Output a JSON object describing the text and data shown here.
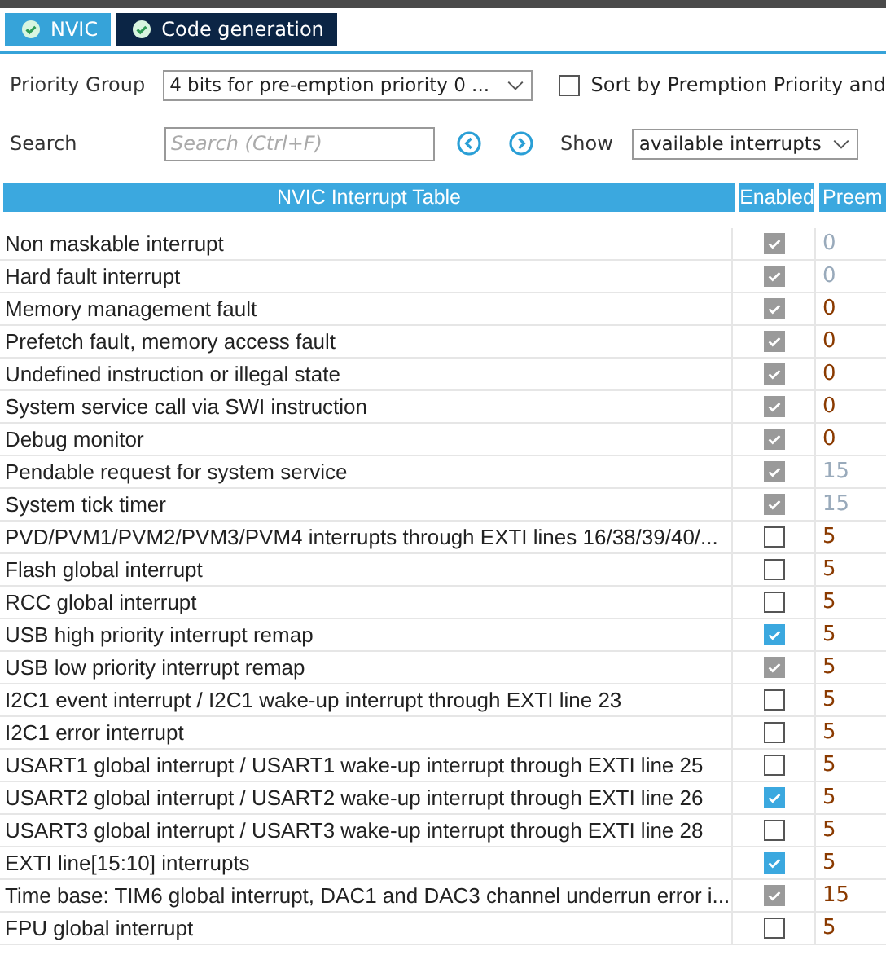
{
  "tabs": [
    {
      "label": "NVIC",
      "selected": true
    },
    {
      "label": "Code generation",
      "selected": false
    }
  ],
  "priority_group": {
    "label": "Priority Group",
    "value": "4 bits for pre-emption priority 0 ..."
  },
  "sort_option": {
    "label": "Sort by Premption Priority and",
    "checked": false
  },
  "search": {
    "label": "Search",
    "placeholder": "Search (Ctrl+F)"
  },
  "show": {
    "label": "Show",
    "value": "available interrupts"
  },
  "table": {
    "columns": [
      "NVIC Interrupt Table",
      "Enabled",
      "Preem"
    ],
    "rows": [
      {
        "name": "Non maskable interrupt",
        "enabled": true,
        "enabled_locked": true,
        "priority": "0",
        "priority_disabled": true
      },
      {
        "name": "Hard fault interrupt",
        "enabled": true,
        "enabled_locked": true,
        "priority": "0",
        "priority_disabled": true
      },
      {
        "name": "Memory management fault",
        "enabled": true,
        "enabled_locked": true,
        "priority": "0",
        "priority_disabled": false
      },
      {
        "name": "Prefetch fault, memory access fault",
        "enabled": true,
        "enabled_locked": true,
        "priority": "0",
        "priority_disabled": false
      },
      {
        "name": "Undefined instruction or illegal state",
        "enabled": true,
        "enabled_locked": true,
        "priority": "0",
        "priority_disabled": false
      },
      {
        "name": "System service call via SWI instruction",
        "enabled": true,
        "enabled_locked": true,
        "priority": "0",
        "priority_disabled": false
      },
      {
        "name": "Debug monitor",
        "enabled": true,
        "enabled_locked": true,
        "priority": "0",
        "priority_disabled": false
      },
      {
        "name": "Pendable request for system service",
        "enabled": true,
        "enabled_locked": true,
        "priority": "15",
        "priority_disabled": true
      },
      {
        "name": "System tick timer",
        "enabled": true,
        "enabled_locked": true,
        "priority": "15",
        "priority_disabled": true
      },
      {
        "name": "PVD/PVM1/PVM2/PVM3/PVM4 interrupts through EXTI lines 16/38/39/40/...",
        "enabled": false,
        "enabled_locked": false,
        "priority": "5",
        "priority_disabled": false
      },
      {
        "name": "Flash global interrupt",
        "enabled": false,
        "enabled_locked": false,
        "priority": "5",
        "priority_disabled": false
      },
      {
        "name": "RCC global interrupt",
        "enabled": false,
        "enabled_locked": false,
        "priority": "5",
        "priority_disabled": false
      },
      {
        "name": "USB high priority interrupt remap",
        "enabled": true,
        "enabled_locked": false,
        "priority": "5",
        "priority_disabled": false
      },
      {
        "name": "USB low priority interrupt remap",
        "enabled": true,
        "enabled_locked": true,
        "priority": "5",
        "priority_disabled": false
      },
      {
        "name": "I2C1 event interrupt / I2C1 wake-up interrupt through EXTI line 23",
        "enabled": false,
        "enabled_locked": false,
        "priority": "5",
        "priority_disabled": false
      },
      {
        "name": "I2C1 error interrupt",
        "enabled": false,
        "enabled_locked": false,
        "priority": "5",
        "priority_disabled": false
      },
      {
        "name": "USART1 global interrupt / USART1 wake-up interrupt through EXTI line 25",
        "enabled": false,
        "enabled_locked": false,
        "priority": "5",
        "priority_disabled": false
      },
      {
        "name": "USART2 global interrupt / USART2 wake-up interrupt through EXTI line 26",
        "enabled": true,
        "enabled_locked": false,
        "priority": "5",
        "priority_disabled": false
      },
      {
        "name": "USART3 global interrupt / USART3 wake-up interrupt through EXTI line 28",
        "enabled": false,
        "enabled_locked": false,
        "priority": "5",
        "priority_disabled": false
      },
      {
        "name": "EXTI line[15:10] interrupts",
        "enabled": true,
        "enabled_locked": false,
        "priority": "5",
        "priority_disabled": false
      },
      {
        "name": "Time base: TIM6 global interrupt, DAC1 and DAC3 channel underrun error i...",
        "enabled": true,
        "enabled_locked": true,
        "priority": "15",
        "priority_disabled": false
      },
      {
        "name": "FPU global interrupt",
        "enabled": false,
        "enabled_locked": false,
        "priority": "5",
        "priority_disabled": false
      }
    ]
  }
}
